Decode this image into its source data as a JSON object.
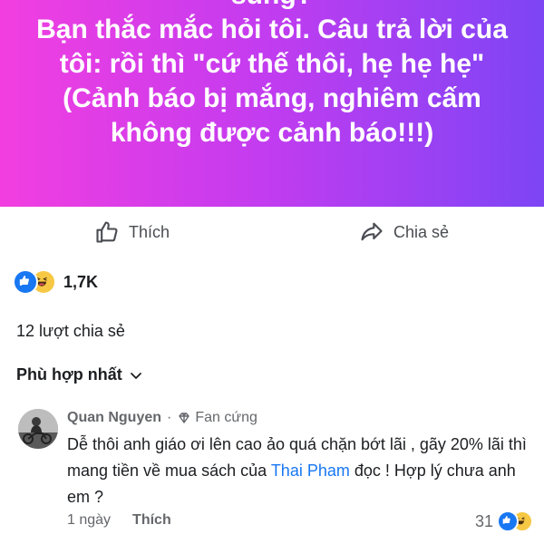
{
  "post": {
    "banner_lines": [
      "sung?",
      "Bạn thắc mắc hỏi tôi. Câu trả lời của",
      "tôi: rồi thì \"cứ thế thôi, hẹ hẹ hẹ\"",
      "(Cảnh báo bị mắng, nghiêm cấm",
      "không được cảnh báo!!!)"
    ],
    "colors": {
      "gradient_start": "#f23ee0",
      "gradient_mid": "#c13cf0",
      "gradient_end": "#7d45f5"
    }
  },
  "actions": {
    "like_label": "Thích",
    "like_icon": "thumbs-up-outline-icon",
    "share_label": "Chia sẻ",
    "share_icon": "share-arrow-icon"
  },
  "stats": {
    "reaction_icons": [
      "like-reaction-icon",
      "haha-reaction-icon"
    ],
    "reaction_count": "1,7K",
    "shares_text": "12 lượt chia sẻ"
  },
  "comments_sort": {
    "label": "Phù hợp nhất",
    "icon": "chevron-down-icon"
  },
  "comment": {
    "author": "Quan Nguyen",
    "separator": "·",
    "badge": "Fan cứng",
    "badge_icon": "diamond-icon",
    "text_before_mention": "Dễ thôi anh giáo ơi lên cao ảo quá chặn bớt lãi , gãy 20% lãi thì mang tiền về mua sách của ",
    "mention": "Thai Pham",
    "text_after_mention": " đọc ! Hợp lý chưa anh em ?",
    "time": "1 ngày",
    "like_label": "Thích",
    "reaction_count": "31",
    "reaction_icons": [
      "like-reaction-icon",
      "haha-reaction-icon"
    ]
  }
}
